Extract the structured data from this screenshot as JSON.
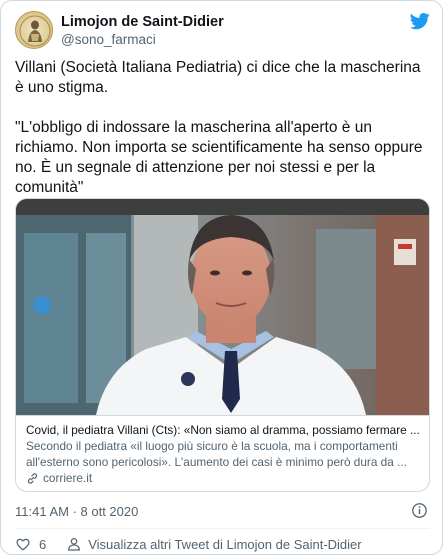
{
  "user": {
    "name": "Limojon de Saint-Didier",
    "handle": "@sono_farmaci"
  },
  "tweet": {
    "text": "Villani (Società Italiana Pediatria) ci dice che la mascherina è uno stigma.\n\n\"L'obbligo di indossare la mascherina all'aperto è un richiamo. Non importa se scientificamente ha senso oppure no. È un segnale di attenzione per noi stessi e per la comunità\""
  },
  "link_card": {
    "title": "Covid, il pediatra Villani (Cts): «Non siamo al dramma, possiamo fermare ...",
    "description": "Secondo il pediatra «il luogo più sicuro è la scuola, ma i comportamenti all'esterno sono pericolosi». L'aumento dei casi è minimo però dura da ...",
    "domain": "corriere.it"
  },
  "meta": {
    "timestamp": "11:41 AM · 8 ott 2020"
  },
  "footer": {
    "likes": "6",
    "more_tweets": "Visualizza altri Tweet di Limojon de Saint-Didier"
  },
  "colors": {
    "twitter_blue": "#1d9bf0",
    "text_primary": "#0f1419",
    "text_secondary": "#536471",
    "border": "#cfd9de"
  },
  "icons": [
    "twitter-bird-icon",
    "link-icon",
    "info-icon",
    "heart-icon",
    "person-icon"
  ]
}
